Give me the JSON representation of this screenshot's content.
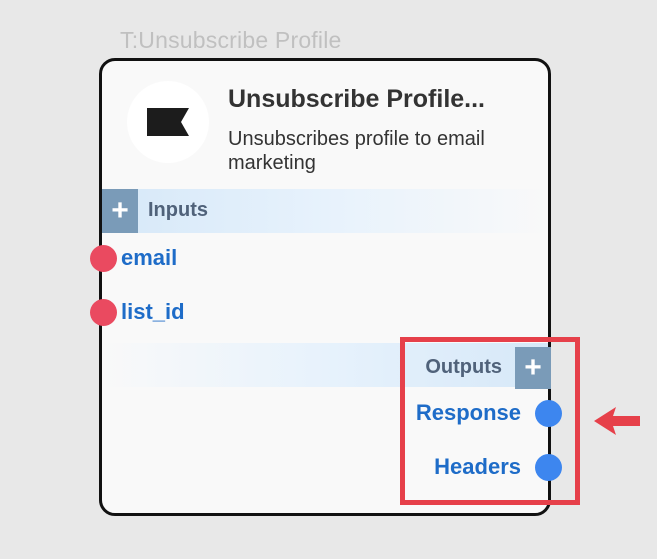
{
  "node": {
    "type_label": "T:Unsubscribe Profile",
    "title": "Unsubscribe Profile...",
    "description": "Unsubscribes profile to email marketing",
    "logo_icon": "klaviyo-flag-icon",
    "inputs": {
      "label": "Inputs",
      "add_label": "+",
      "ports": [
        {
          "label": "email"
        },
        {
          "label": "list_id"
        }
      ]
    },
    "outputs": {
      "label": "Outputs",
      "add_label": "+",
      "ports": [
        {
          "label": "Response"
        },
        {
          "label": "Headers"
        }
      ]
    }
  },
  "colors": {
    "input_port": "#ea4a60",
    "output_port": "#3d86ef",
    "port_label": "#1e6cc8",
    "highlight": "#e6404a",
    "section_button": "#7a9bb8"
  },
  "annotation": {
    "arrow_icon": "red-arrow-icon",
    "highlight_target": "outputs-section"
  }
}
